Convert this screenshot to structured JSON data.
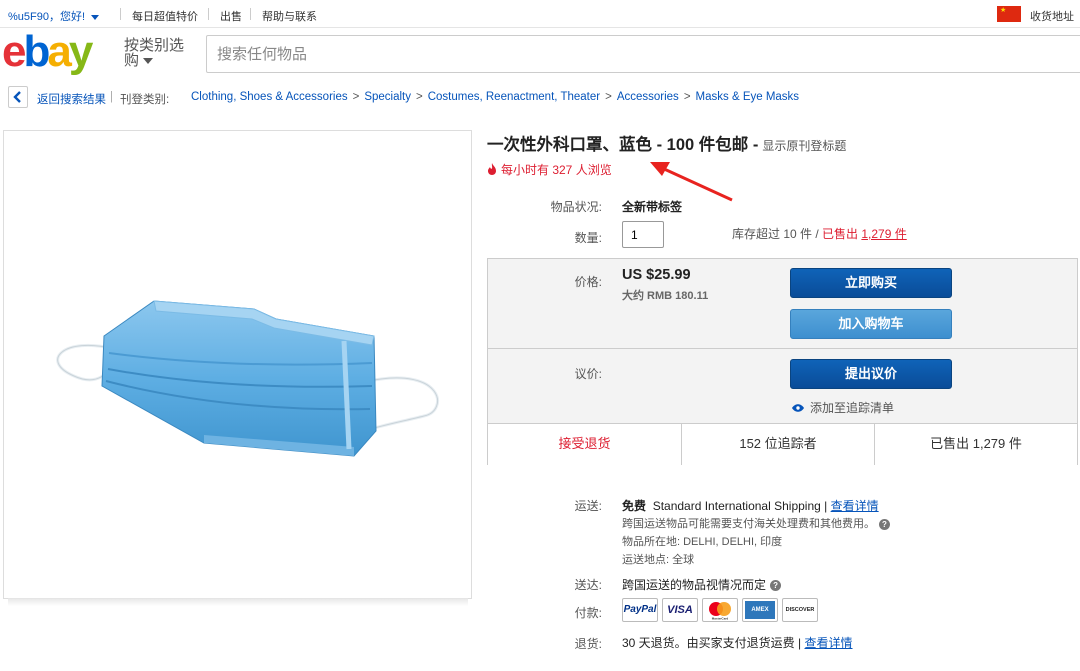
{
  "topbar": {
    "greeting": "%u5F90，您好!",
    "daily_deals": "每日超值特价",
    "sell": "出售",
    "help": "帮助与联系",
    "ship_to": "收货地址"
  },
  "header": {
    "shop_by_category": "按类别选购",
    "search_placeholder": "搜索任何物品"
  },
  "breadcrumb": {
    "back": "返回搜索结果",
    "listed_in": "刊登类别:",
    "items": [
      "Clothing, Shoes & Accessories",
      "Specialty",
      "Costumes, Reenactment, Theater",
      "Accessories",
      "Masks & Eye Masks"
    ],
    "separator": ">"
  },
  "item": {
    "title": "一次性外科口罩、蓝色 - 100 件包邮 -",
    "show_original": "显示原刊登标题",
    "viewers": "每小时有 327 人浏览",
    "condition_label": "物品状况:",
    "condition_value": "全新带标签",
    "qty_label": "数量:",
    "qty_value": "1",
    "stock_text": "库存超过 10 件 / ",
    "sold_text": "已售出 ",
    "sold_count": "1,279 件"
  },
  "buybox": {
    "price_label": "价格:",
    "price": "US $25.99",
    "approx": "大约 RMB 180.11",
    "buy_now": "立即购买",
    "add_to_cart": "加入购物车",
    "offer_label": "议价:",
    "make_offer": "提出议价",
    "watchlist": "添加至追踪清单",
    "returns_accepted": "接受退货",
    "watchers": "152 位追踪者",
    "sold": "已售出 1,279 件"
  },
  "shipping": {
    "label": "运送:",
    "free": "免费",
    "method": "Standard International Shipping |",
    "details": "查看详情",
    "note": "跨国运送物品可能需要支付海关处理费和其他费用。",
    "location": "物品所在地:   DELHI, DELHI, 印度",
    "ships_to": "运送地点:   全球"
  },
  "delivery": {
    "label": "送达:",
    "value": "跨国运送的物品视情况而定"
  },
  "payment": {
    "label": "付款:",
    "methods": [
      "PayPal",
      "VISA",
      "MasterCard",
      "AMEX",
      "DISCOVER"
    ]
  },
  "returns": {
    "label": "退货:",
    "value": "30 天退货。由买家支付退货运费 |",
    "details": "查看详情"
  },
  "colors": {
    "accent_red": "#dd1e31",
    "link_blue": "#0654ba",
    "button_blue": "#0a4c98"
  }
}
